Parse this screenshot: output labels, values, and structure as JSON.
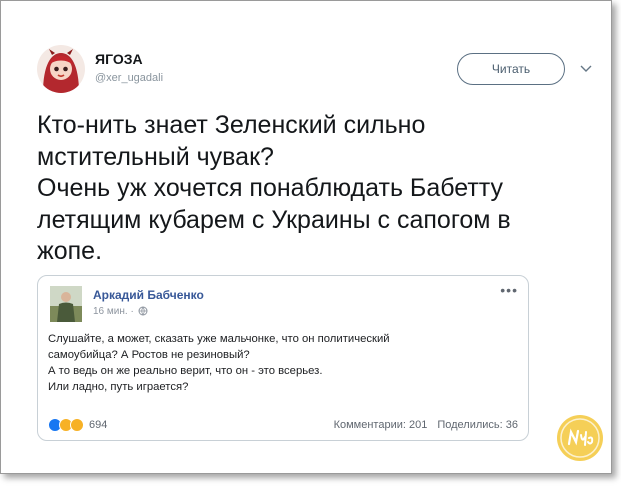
{
  "tweet": {
    "author_name": "ЯГОЗА",
    "author_handle": "@xer_ugadali",
    "follow_label": "Читать",
    "lines": [
      "Кто-нить знает Зеленский сильно",
      "мстительный чувак?",
      "Очень уж хочется понаблюдать Бабетту",
      "летящим кубарем с Украины с сапогом в",
      "жопе."
    ]
  },
  "embed": {
    "author_name": "Аркадий Бабченко",
    "time": "16 мин. ·",
    "menu": "•••",
    "lines": [
      "Слушайте, а может, сказать уже мальчонке, что он политический",
      "самоубийца? А Ростов не резиновый?",
      "А то ведь он же реально верит, что он - это всерьез.",
      "Или ладно, путь играется?"
    ],
    "reactions_count": "694",
    "comments": "Комментарии: 201",
    "shares": "Поделились: 36"
  },
  "watermark": "Nyka",
  "colors": {
    "fb_name": "#385898",
    "follow_border": "#5b7083",
    "react_like": "#1877f2",
    "react_haha": "#f7b125",
    "react_sad": "#f7b125",
    "watermark": "#e8b42c"
  }
}
